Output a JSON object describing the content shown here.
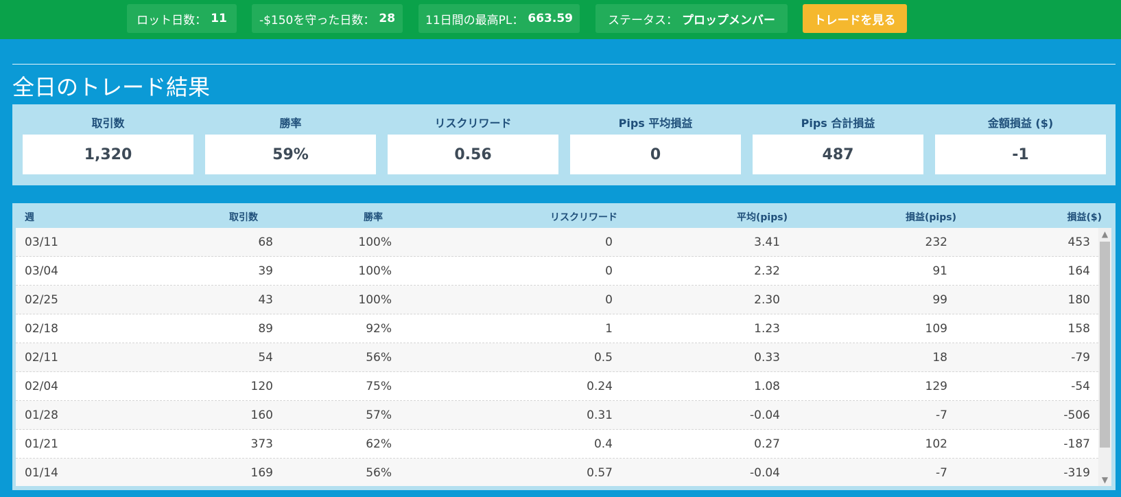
{
  "topbar": {
    "stats": [
      {
        "label": "ロット日数：",
        "value": "11"
      },
      {
        "label": "-$150を守った日数：",
        "value": "28"
      },
      {
        "label": "11日間の最高PL：",
        "value": "663.59"
      },
      {
        "label": "ステータス：",
        "value": "プロップメンバー"
      }
    ],
    "cta_label": "トレードを見る"
  },
  "page_title": "全日のトレード結果",
  "summary": [
    {
      "label": "取引数",
      "value": "1,320"
    },
    {
      "label": "勝率",
      "value": "59%"
    },
    {
      "label": "リスクリワード",
      "value": "0.56"
    },
    {
      "label": "Pips 平均損益",
      "value": "0"
    },
    {
      "label": "Pips 合計損益",
      "value": "487"
    },
    {
      "label": "金額損益 ($)",
      "value": "-1"
    }
  ],
  "table": {
    "headers": [
      "週",
      "取引数",
      "勝率",
      "リスクリワード",
      "平均(pips)",
      "損益(pips)",
      "損益($)"
    ],
    "rows": [
      [
        "03/11",
        "68",
        "100%",
        "0",
        "3.41",
        "232",
        "453"
      ],
      [
        "03/04",
        "39",
        "100%",
        "0",
        "2.32",
        "91",
        "164"
      ],
      [
        "02/25",
        "43",
        "100%",
        "0",
        "2.30",
        "99",
        "180"
      ],
      [
        "02/18",
        "89",
        "92%",
        "1",
        "1.23",
        "109",
        "158"
      ],
      [
        "02/11",
        "54",
        "56%",
        "0.5",
        "0.33",
        "18",
        "-79"
      ],
      [
        "02/04",
        "120",
        "75%",
        "0.24",
        "1.08",
        "129",
        "-54"
      ],
      [
        "01/28",
        "160",
        "57%",
        "0.31",
        "-0.04",
        "-7",
        "-506"
      ],
      [
        "01/21",
        "373",
        "62%",
        "0.4",
        "0.27",
        "102",
        "-187"
      ],
      [
        "01/14",
        "169",
        "56%",
        "0.57",
        "-0.04",
        "-7",
        "-319"
      ]
    ]
  },
  "scrollbar": {
    "up_icon": "chevron-up-icon",
    "down_icon": "chevron-down-icon"
  },
  "colors": {
    "topbar": "#0aa24a",
    "background": "#0b9ad6",
    "cta": "#f5b82e",
    "panel": "#b4e0f0",
    "header_text": "#1f4f7a"
  }
}
